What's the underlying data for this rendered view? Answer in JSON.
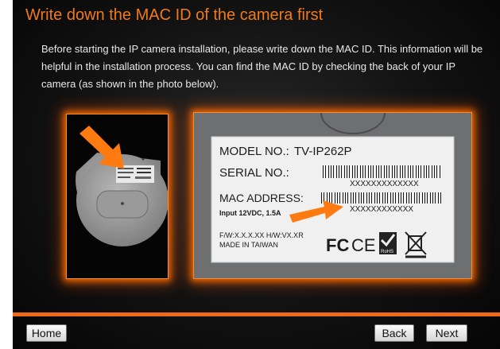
{
  "title": "Write down the MAC ID of the camera first",
  "description": "Before starting the IP camera installation, please write down the MAC ID. This information will be helpful in the installation process. You can find the MAC ID by checking the back of your IP camera (as shown in the photo below).",
  "photo_label": {
    "model_no": "MODEL NO.:",
    "model_value": "TV-IP262P",
    "serial_no": "SERIAL NO.:",
    "serial_code": "XXXXXXXXXXXXX",
    "mac_address": "MAC ADDRESS:",
    "mac_code": "XXXXXXXXXXXX",
    "input": "Input  12VDC, 1.5A",
    "firmware": "F/W:X.X.X.XX   H/W:VX.XR",
    "made_in": "MADE IN TAIWAN",
    "fc_mark": "FC",
    "ce_mark": "CE",
    "rohs_mark": "RoHS"
  },
  "buttons": {
    "home": "Home",
    "back": "Back",
    "next": "Next"
  },
  "colors": {
    "accent": "#f07a1a",
    "divider": "#ee6a18",
    "background": "#141414"
  },
  "icons": [
    "arrow-icon",
    "fcc-icon",
    "ce-icon",
    "rohs-icon",
    "weee-icon"
  ]
}
